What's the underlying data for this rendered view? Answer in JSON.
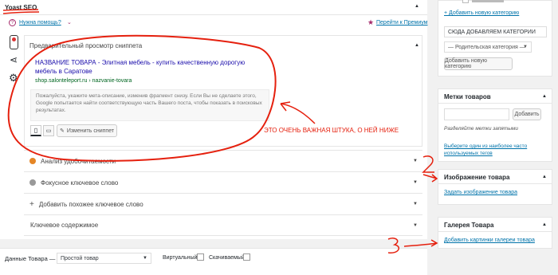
{
  "yoast": {
    "title": "Yoast SEO",
    "need_help": "Нужна помощь?",
    "premium": "Перейти к Премиум",
    "preview_heading": "Предварительный просмотр сниппета",
    "snippet_title": "НАЗВАНИЕ ТОВАРА - Элитная мебель - купить качественную дорогую мебель в Саратове",
    "snippet_url": "shop.salonteleport.ru › nazvanie-tovara",
    "snippet_desc": "Пожалуйста, укажите мета-описание, изменив фрагмент снизу. Если Вы не сделаете этого, Google попытается найти соответствующую часть Вашего поста, чтобы показать в поисковых результатах.",
    "edit_snippet": "Изменить сниппет",
    "rows": [
      {
        "label": "Анализ удобочитаемости",
        "dot": "#e58626"
      },
      {
        "label": "Фокусное ключевое слово",
        "dot": "#999999"
      },
      {
        "label": "Добавить похожее ключевое слово",
        "dot": "plus"
      },
      {
        "label": "Ключевое содержимое",
        "dot": "none"
      }
    ]
  },
  "annotations": {
    "important": "ЭТО ОЧЕНЬ ВАЖНАЯ ШТУКА, О НЕЙ НИЖЕ",
    "num2": "2",
    "num3": "3"
  },
  "product_data": {
    "label": "Данные Товара —",
    "type_value": "Простой товар",
    "virtual": "Виртуальный:",
    "downloadable": "Скачиваемый:"
  },
  "sidebar": {
    "add_category_link": "+ Добавить новую категорию",
    "category_input": "СЮДА ДОБАВЛЯЕМ КАТЕГОРИИ",
    "parent_select": "— Родительская категория —",
    "add_category_btn": "Добавить новую категорию",
    "tags_title": "Метки товаров",
    "tags_add_btn": "Добавить",
    "tags_hint": "Разделяйте метки запятыми",
    "tags_choose": "Выберите один из наиболее часто используемых тегов",
    "image_title": "Изображение товара",
    "image_link": "Задать изображение товара",
    "gallery_title": "Галерея Товара",
    "gallery_link": "Добавить картинки галереи товара"
  }
}
